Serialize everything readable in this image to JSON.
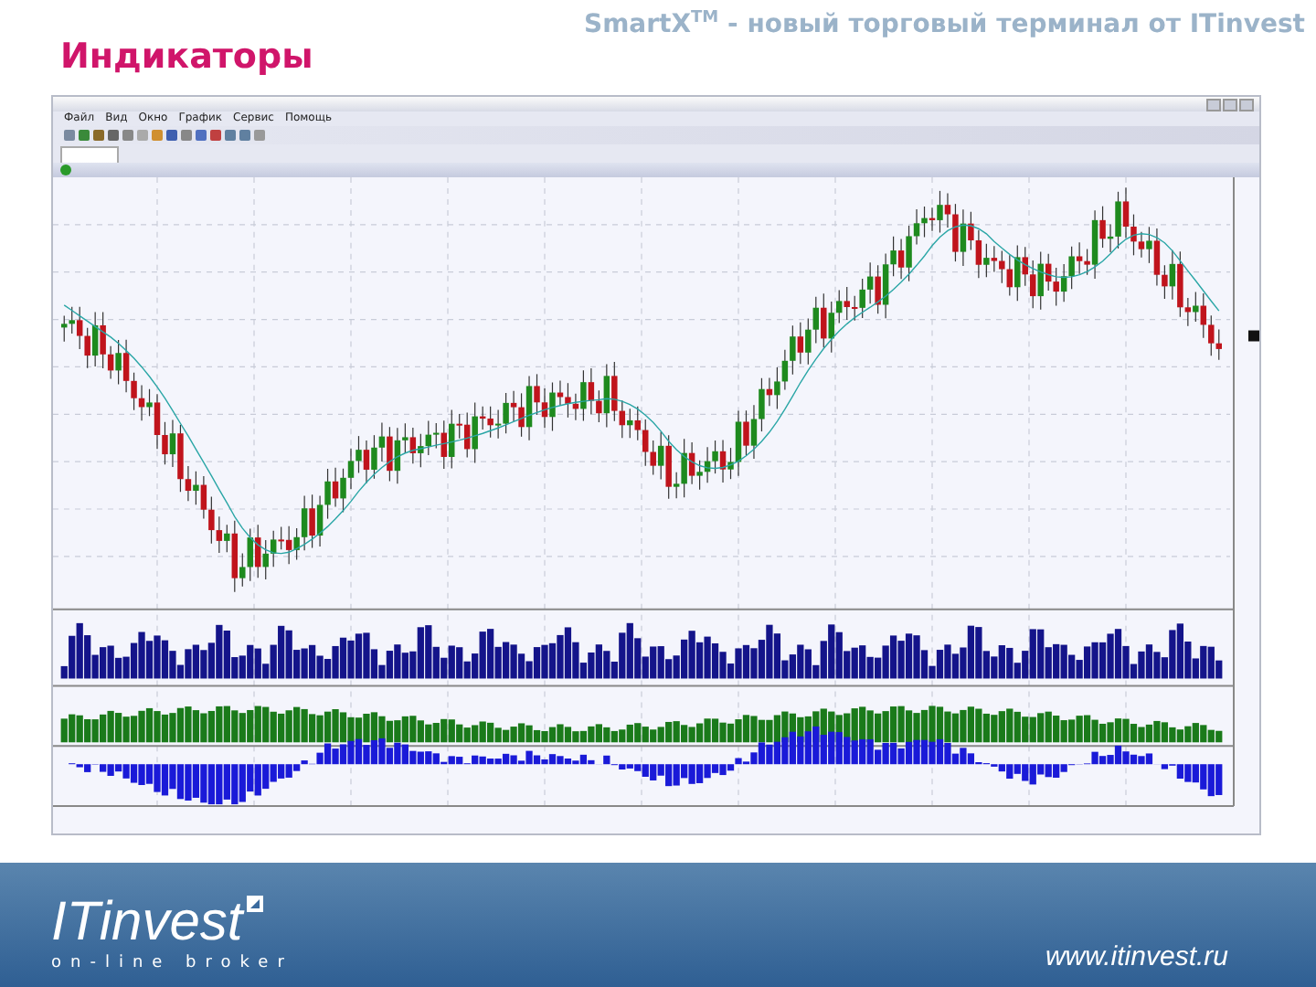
{
  "slide": {
    "title": "Индикаторы",
    "header": "SmartX$^{TM}$ - новый торговый терминал от ITinvest"
  },
  "app": {
    "menu": [
      "Файл",
      "Вид",
      "Окно",
      "График",
      "Сервис",
      "Помощь"
    ]
  },
  "footer": {
    "logo": "ITinvest",
    "tagline": "on-line broker",
    "url": "www.itinvest.ru"
  }
}
